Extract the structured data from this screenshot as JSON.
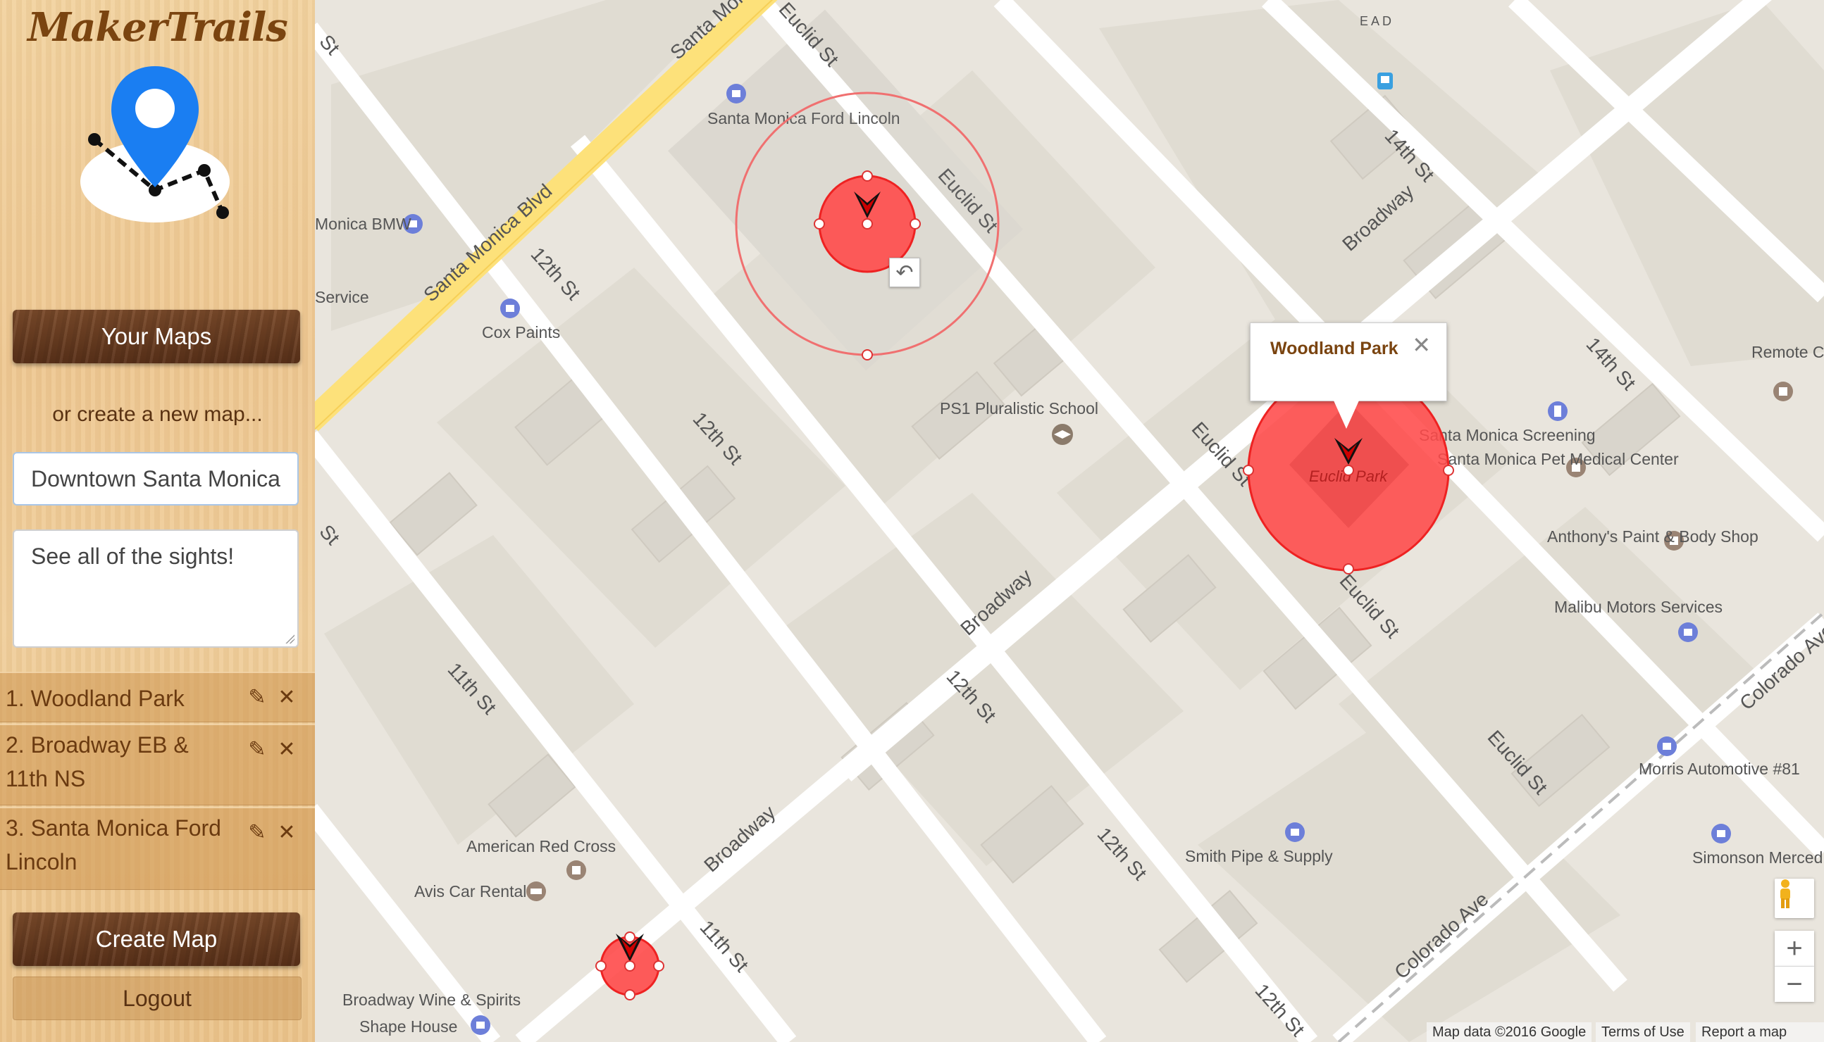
{
  "app": {
    "title": "MakerTrails"
  },
  "sidebar": {
    "your_maps_label": "Your Maps",
    "create_prompt": "or create a new map...",
    "map_name_value": "Downtown Santa Monica",
    "map_description_value": "See all of the sights!",
    "stops": [
      {
        "label": "1. Woodland Park"
      },
      {
        "label": "2. Broadway EB & 11th NS"
      },
      {
        "label": "3. Santa Monica Ford Lincoln"
      }
    ],
    "create_map_label": "Create Map",
    "logout_label": "Logout"
  },
  "map": {
    "info_window_title": "Woodland Park",
    "place_labels": {
      "ford_lincoln": "Santa Monica Ford Lincoln",
      "bmw": "Monica BMW",
      "service": "Service",
      "cox_paints": "Cox Paints",
      "school": "PS1 Pluralistic School",
      "euclid_park": "Euclid Park",
      "screening": "Santa Monica Screening",
      "pet_medical": "Santa Monica Pet Medical Center",
      "anthonys": "Anthony's Paint & Body Shop",
      "malibu_motors": "Malibu Motors Services",
      "morris": "Morris Automotive #81",
      "simonson": "Simonson Merced",
      "remote": "Remote Co Production",
      "smith_pipe": "Smith Pipe & Supply",
      "red_cross": "American Red Cross",
      "avis": "Avis Car Rental",
      "broadway_wine": "Broadway Wine & Spirits",
      "shape_house": "Shape House",
      "eda": "E  A  D"
    },
    "street_labels": {
      "santa_monica_blvd": "Santa Monica Blvd",
      "euclid": "Euclid St",
      "fourteenth": "14th St",
      "twelfth": "12th St",
      "eleventh": "11th St",
      "broadway": "Broadway",
      "colorado": "Colorado Ave",
      "st": "St"
    },
    "footer": {
      "map_data": "Map data ©2016 Google",
      "terms": "Terms of Use",
      "report": "Report a map error"
    },
    "marker_color": "#ff4a4a",
    "accent": "#1a73e8"
  }
}
